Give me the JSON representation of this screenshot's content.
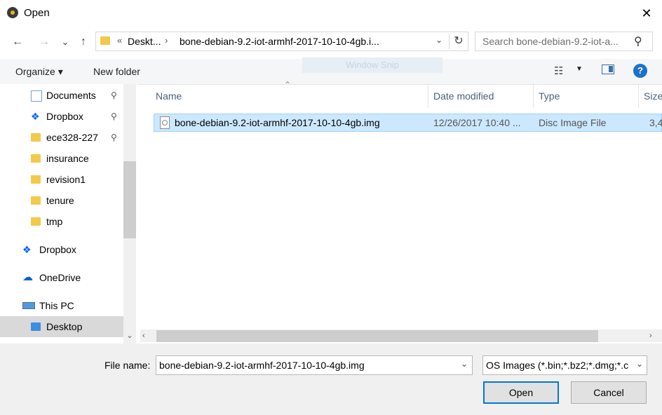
{
  "window": {
    "title": "Open",
    "close_glyph": "✕"
  },
  "nav": {
    "back_glyph": "←",
    "forward_glyph": "→",
    "recent_glyph": "⌄",
    "up_glyph": "↑",
    "breadcrumb_sep1": "«",
    "breadcrumb": [
      "Deskt...",
      "bone-debian-9.2-iot-armhf-2017-10-10-4gb.i..."
    ],
    "breadcrumb_sep2": "›",
    "dropdown_glyph": "⌄",
    "refresh_glyph": "↻",
    "search_placeholder": "Search bone-debian-9.2-iot-a...",
    "search_icon": "search-icon"
  },
  "commands": {
    "organize": "Organize ▾",
    "new_folder": "New folder",
    "overlay_text": "Window Snip",
    "view_glyph": "☷",
    "view_dd": "▼",
    "help": "?"
  },
  "sidebar": {
    "items": [
      {
        "label": "Documents",
        "pinned": true
      },
      {
        "label": "Dropbox",
        "pinned": true
      },
      {
        "label": "ece328-227",
        "pinned": true
      },
      {
        "label": "insurance",
        "pinned": false
      },
      {
        "label": "revision1",
        "pinned": false
      },
      {
        "label": "tenure",
        "pinned": false
      },
      {
        "label": "tmp",
        "pinned": false
      },
      {
        "label": "Dropbox",
        "pinned": false
      },
      {
        "label": "OneDrive",
        "pinned": false
      },
      {
        "label": "This PC",
        "pinned": false
      },
      {
        "label": "Desktop",
        "pinned": false,
        "selected": true
      }
    ],
    "pin_glyph": "📌",
    "scroll_down": "⌄"
  },
  "file_list": {
    "columns": [
      "Name",
      "Date modified",
      "Type",
      "Size"
    ],
    "sort_glyph": "⌃",
    "rows": [
      {
        "name": "bone-debian-9.2-iot-armhf-2017-10-10-4gb.img",
        "date": "12/26/2017 10:40 ...",
        "type": "Disc Image File",
        "size": "3,4"
      }
    ],
    "scroll_left": "‹",
    "scroll_right": "›"
  },
  "bottom": {
    "filename_label": "File name:",
    "filename_value": "bone-debian-9.2-iot-armhf-2017-10-10-4gb.img",
    "filetype_value": "OS Images (*.bin;*.bz2;*.dmg;*.c",
    "dd_glyph": "⌄",
    "open_label": "Open",
    "cancel_label": "Cancel"
  },
  "colors": {
    "selection": "#cce8ff",
    "accent": "#0078d7",
    "folder": "#f2c94c"
  }
}
